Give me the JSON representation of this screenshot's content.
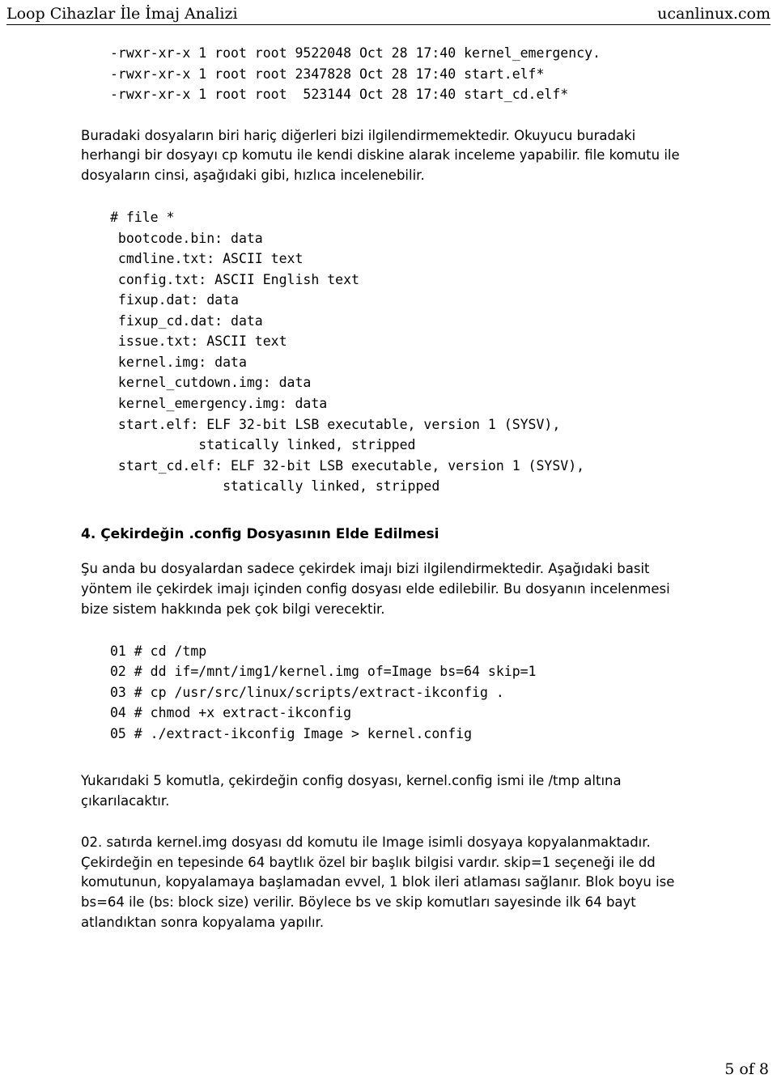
{
  "header": {
    "left": "Loop Cihazlar İle İmaj Analizi",
    "right": "ucanlinux.com"
  },
  "code1": "-rwxr-xr-x 1 root root 9522048 Oct 28 17:40 kernel_emergency.\n-rwxr-xr-x 1 root root 2347828 Oct 28 17:40 start.elf*\n-rwxr-xr-x 1 root root  523144 Oct 28 17:40 start_cd.elf*",
  "para1": "Buradaki dosyaların biri hariç diğerleri bizi ilgilendirmemektedir. Okuyucu buradaki herhangi  bir dosyayı cp komutu ile kendi diskine alarak inceleme yapabilir. file komutu ile dosyaların cinsi, aşağıdaki gibi, hızlıca incelenebilir.",
  "code2": "# file *\n bootcode.bin: data\n cmdline.txt: ASCII text\n config.txt: ASCII English text\n fixup.dat: data\n fixup_cd.dat: data\n issue.txt: ASCII text\n kernel.img: data\n kernel_cutdown.img: data\n kernel_emergency.img: data\n start.elf: ELF 32-bit LSB executable, version 1 (SYSV),\n           statically linked, stripped\n start_cd.elf: ELF 32-bit LSB executable, version 1 (SYSV),\n              statically linked, stripped",
  "heading1": "4. Çekirdeğin .config Dosyasının Elde Edilmesi",
  "para2": "Şu anda bu dosyalardan sadece çekirdek imajı bizi ilgilendirmektedir. Aşağıdaki basit yöntem ile çekirdek imajı içinden config dosyası elde edilebilir. Bu dosyanın incelenmesi bize sistem hakkında pek çok bilgi verecektir.",
  "code3": "01 # cd /tmp\n02 # dd if=/mnt/img1/kernel.img of=Image bs=64 skip=1\n03 # cp /usr/src/linux/scripts/extract-ikconfig .\n04 # chmod +x extract-ikconfig\n05 # ./extract-ikconfig Image > kernel.config",
  "para3": "Yukarıdaki 5 komutla, çekirdeğin config dosyası, kernel.config ismi ile /tmp altına çıkarılacaktır.",
  "para4": "02. satırda kernel.img dosyası dd komutu ile Image isimli dosyaya kopyalanmaktadır. Çekirdeğin en tepesinde 64 baytlık özel bir başlık bilgisi vardır. skip=1 seçeneği ile dd komutunun, kopyalamaya başlamadan evvel, 1 blok ileri atlaması sağlanır. Blok boyu ise bs=64 ile (bs: block size) verilir. Böylece bs ve skip komutları sayesinde ilk 64 bayt atlandıktan sonra kopyalama yapılır.",
  "footer": "5 of 8"
}
